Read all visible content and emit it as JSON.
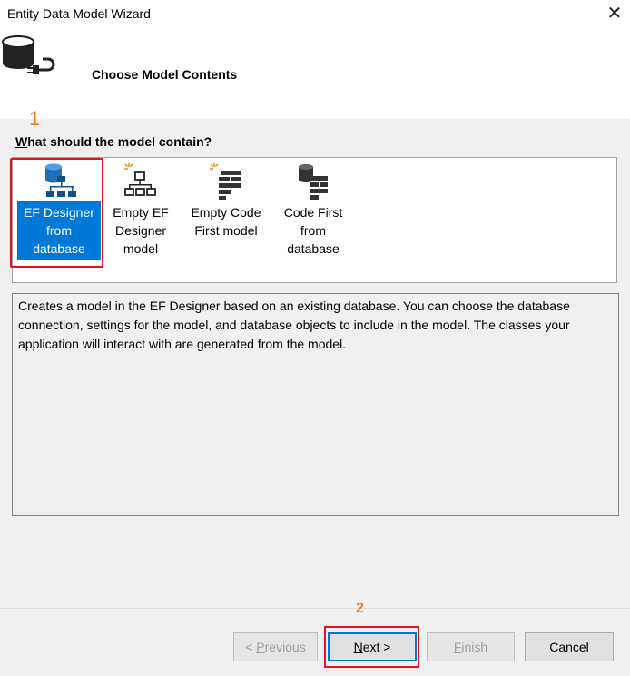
{
  "window": {
    "title": "Entity Data Model Wizard",
    "close_glyph": "✕"
  },
  "header": {
    "title": "Choose Model Contents",
    "icon": "database-plug-icon"
  },
  "annotations": {
    "step1": "1",
    "step2": "2",
    "highlight_color": "#e81123",
    "number_color": "#f07c14"
  },
  "question": {
    "access_key": "W",
    "rest": "hat should the model contain?"
  },
  "models": [
    {
      "label_lines": [
        "EF Designer",
        "from",
        "database"
      ],
      "icon": "database-hierarchy-icon",
      "selected": true
    },
    {
      "label_lines": [
        "Empty EF",
        "Designer",
        "model"
      ],
      "icon": "new-hierarchy-icon",
      "selected": false
    },
    {
      "label_lines": [
        "Empty Code",
        "First model"
      ],
      "icon": "new-code-first-icon",
      "selected": false
    },
    {
      "label_lines": [
        "Code First",
        "from",
        "database"
      ],
      "icon": "database-code-first-icon",
      "selected": false
    }
  ],
  "description": "Creates a model in the EF Designer based on an existing database. You can choose the database connection, settings for the model, and database objects to include in the model. The classes your application will interact with are generated from the model.",
  "buttons": {
    "previous": {
      "prefix": "< ",
      "access_key": "P",
      "rest": "revious",
      "enabled": false
    },
    "next": {
      "access_key": "N",
      "rest": "ext >",
      "enabled": true
    },
    "finish": {
      "access_key": "F",
      "rest": "inish",
      "enabled": false
    },
    "cancel": {
      "label": "Cancel",
      "enabled": true
    }
  },
  "colors": {
    "selection": "#0078d7",
    "content_bg": "#f0f0f0"
  }
}
